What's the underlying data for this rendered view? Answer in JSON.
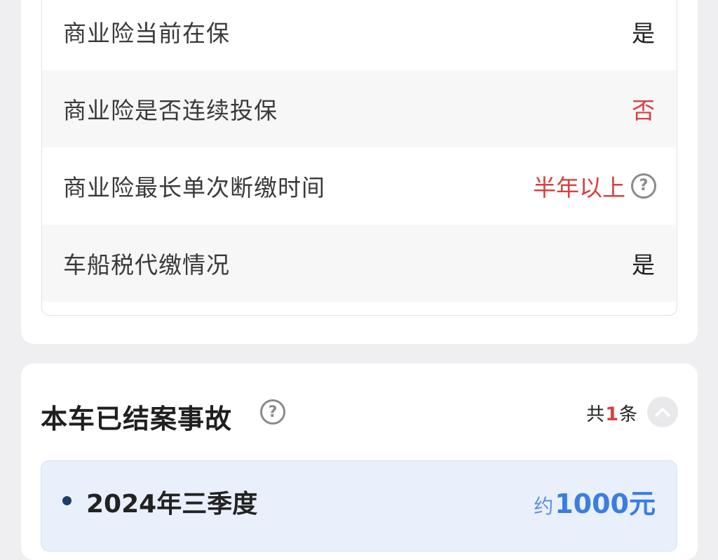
{
  "insurance_table": {
    "rows": [
      {
        "label": "商业险当前在保",
        "value": "是"
      },
      {
        "label": "商业险是否连续投保",
        "value": "否"
      },
      {
        "label": "商业险最长单次断缴时间",
        "value": "半年以上"
      },
      {
        "label": "车船税代缴情况",
        "value": "是"
      }
    ],
    "help_glyph": "?"
  },
  "accidents": {
    "title": "本车已结案事故",
    "help_glyph": "?",
    "count_prefix": "共",
    "count_value": "1",
    "count_suffix": "条",
    "items": [
      {
        "period": "2024年三季度",
        "amount_prefix": "约",
        "amount": "1000元"
      }
    ]
  },
  "colors": {
    "warning_red": "#d94040",
    "accent_blue": "#3b7de0",
    "item_bg": "#e9f0fc"
  },
  "icons": [
    "question-circle-icon",
    "chevron-up-icon",
    "bullet-dot-icon"
  ]
}
